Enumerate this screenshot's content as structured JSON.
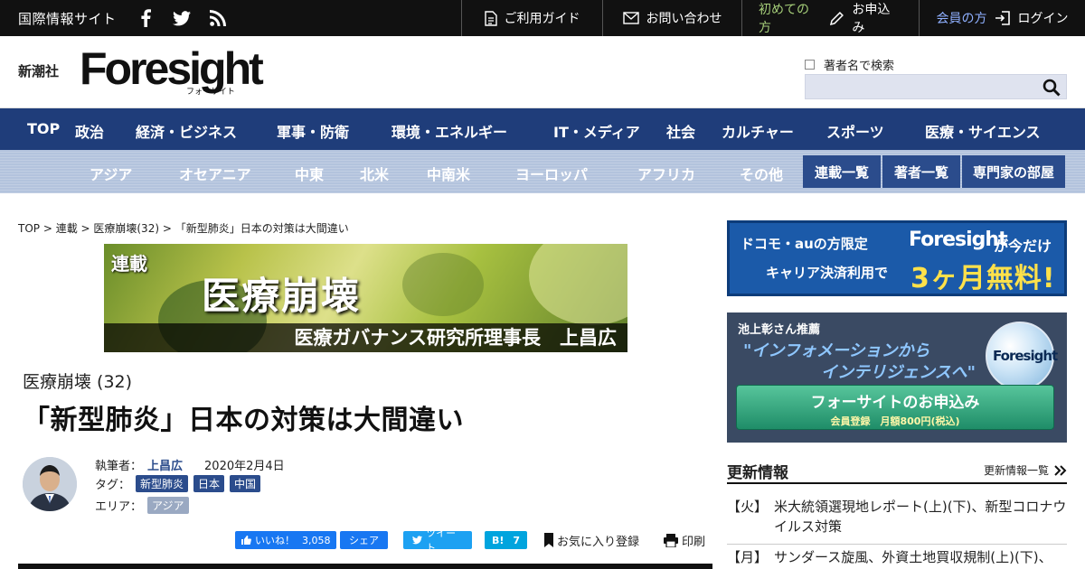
{
  "topbar": {
    "site_name": "国際情報サイト",
    "links": {
      "guide": "ご利用ガイド",
      "contact": "お問い合わせ",
      "first_time": "初めての方",
      "apply": "お申込み",
      "member": "会員の方",
      "login": "ログイン"
    }
  },
  "header": {
    "publisher": "新潮社",
    "logo": "Foresight",
    "logo_sub": "フォーサイト",
    "author_search_label": "著者名で検索"
  },
  "nav_main": [
    "TOP",
    "政治",
    "経済・ビジネス",
    "軍事・防衛",
    "環境・エネルギー",
    "IT・メディア",
    "社会",
    "カルチャー",
    "スポーツ",
    "医療・サイエンス"
  ],
  "nav_regions": [
    "アジア",
    "オセアニア",
    "中東",
    "北米",
    "中南米",
    "ヨーロッパ",
    "アフリカ",
    "その他"
  ],
  "nav_buttons": [
    "連載一覧",
    "著者一覧",
    "専門家の部屋"
  ],
  "breadcrumb": "TOP > 連載 > 医療崩壊(32) > 「新型肺炎」日本の対策は大間違い",
  "banner": {
    "label": "連載",
    "title": "医療崩壊",
    "subtitle": "医療ガバナンス研究所理事長　上昌広"
  },
  "article": {
    "series": "医療崩壊 (32)",
    "title": "「新型肺炎」日本の対策は大間違い",
    "author_label": "執筆者：",
    "author": "上昌広",
    "date": "2020年2月4日",
    "tags_label": "タグ：",
    "tags": [
      "新型肺炎",
      "日本",
      "中国"
    ],
    "area_label": "エリア：",
    "area": "アジア"
  },
  "share": {
    "fb_like": "いいね！",
    "fb_count": "3,058",
    "fb_share": "シェア",
    "tweet": "ツイート",
    "hatena": "B!",
    "hatena_count": "7",
    "favorite": "お気に入り登録",
    "print": "印刷"
  },
  "sidebar": {
    "ad1": {
      "line1": "ドコモ・auの方限定",
      "line2": "キャリア決済利用で",
      "brand": "Foresight",
      "now": "が今だけ",
      "free": "3ヶ月無料!"
    },
    "ad2": {
      "recommend": "池上彰さん推薦",
      "quote1": "\"インフォメーションから",
      "quote2": "インテリジェンスへ\"",
      "globe_text": "Foresight",
      "cta": "フォーサイトのお申込み",
      "cta_sub": "会員登録　月額800円(税込)"
    },
    "updates": {
      "heading": "更新情報",
      "more": "更新情報一覧",
      "items": [
        {
          "day": "【火】",
          "text": "米大統領選現地レポート(上)(下)、新型コロナウイルス対策"
        },
        {
          "day": "【月】",
          "text": "サンダース旋風、外資土地買収規制(上)(下)、"
        }
      ]
    }
  }
}
